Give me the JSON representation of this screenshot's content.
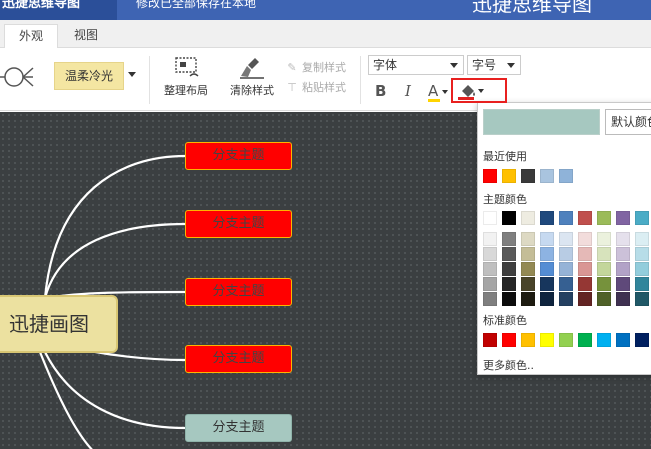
{
  "titlebar": {
    "logo_text": "迅捷思维导图",
    "notice": "修改已全部保存在本地",
    "app_title": "迅捷思维导图"
  },
  "tabs": [
    {
      "label": "外观",
      "active": true
    },
    {
      "label": "视图",
      "active": false
    }
  ],
  "toolbar": {
    "theme_label": "温柔冷光",
    "arrange_label": "整理布局",
    "clear_style_label": "清除样式",
    "copy_style_label": "复制样式",
    "paste_style_label": "粘贴样式",
    "font_label": "字体",
    "font_size_label": "字号",
    "bold_label": "B",
    "italic_label": "I",
    "font_color_label": "A",
    "font_color_bar": "#ffd400",
    "fill_color_bar": "#e02020"
  },
  "mindmap": {
    "center": "迅捷画图",
    "branches": [
      {
        "label": "分支主题",
        "style": "red"
      },
      {
        "label": "分支主题",
        "style": "red"
      },
      {
        "label": "分支主题",
        "style": "red"
      },
      {
        "label": "分支主题",
        "style": "red"
      },
      {
        "label": "分支主题",
        "style": "teal"
      }
    ]
  },
  "color_popup": {
    "preview_color": "#a6c8c0",
    "default_label": "默认颜色",
    "recent_label": "最近使用",
    "recent": [
      "#ff0000",
      "#ffc000",
      "#3a3a3a",
      "#a9c4df",
      "#8fb3d9"
    ],
    "theme_label": "主题颜色",
    "theme_top": [
      "#ffffff",
      "#000000",
      "#eeece1",
      "#1f497d",
      "#4f81bd",
      "#c0504d",
      "#9bbb59",
      "#8064a2",
      "#4bacc6"
    ],
    "theme_shades": [
      [
        "#f2f2f2",
        "#7f7f7f",
        "#ddd9c3",
        "#c6d9f0",
        "#dbe5f1",
        "#f2dcdb",
        "#ebf1dd",
        "#e5e0ec",
        "#dbeef3"
      ],
      [
        "#d8d8d8",
        "#595959",
        "#c4bd97",
        "#8db3e2",
        "#b8cce4",
        "#e5b9b7",
        "#d7e3bc",
        "#ccc1d9",
        "#b7dde8"
      ],
      [
        "#bfbfbf",
        "#3f3f3f",
        "#938953",
        "#548dd4",
        "#95b3d7",
        "#d99694",
        "#c3d69b",
        "#b2a2c7",
        "#92cddc"
      ],
      [
        "#a5a5a5",
        "#262626",
        "#494429",
        "#17365d",
        "#366092",
        "#953734",
        "#76923c",
        "#5f497a",
        "#31859b"
      ],
      [
        "#7f7f7f",
        "#0c0c0c",
        "#1d1b10",
        "#0f243e",
        "#244061",
        "#632423",
        "#4f6128",
        "#3f3151",
        "#205867"
      ]
    ],
    "standard_label": "标准颜色",
    "standard": [
      "#c00000",
      "#ff0000",
      "#ffc000",
      "#ffff00",
      "#92d050",
      "#00b050",
      "#00b0f0",
      "#0070c0",
      "#002060"
    ],
    "more_label": "更多颜色.."
  }
}
